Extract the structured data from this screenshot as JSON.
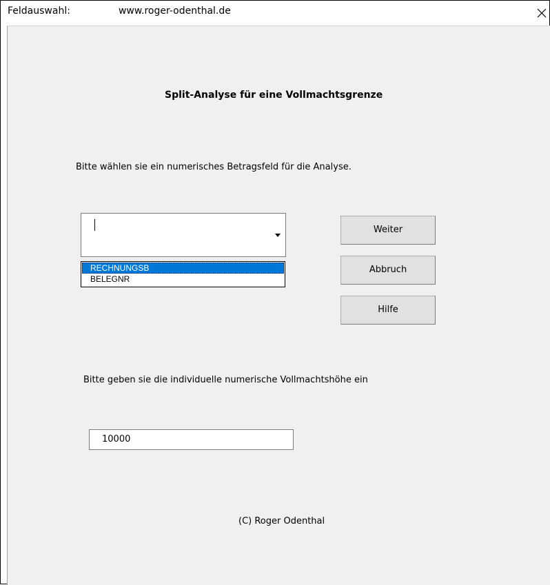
{
  "window": {
    "title": "Feldauswahl:",
    "url": "www.roger-odenthal.de"
  },
  "heading": "Split-Analyse für eine Vollmachtsgrenze",
  "field_prompt": "Bitte wählen sie ein numerisches Betragsfeld für die Analyse.",
  "field_combo": {
    "value": "",
    "options": [
      "RECHNUNGSB",
      "BELEGNR"
    ],
    "selected": "RECHNUNGSB"
  },
  "buttons": {
    "next": "Weiter",
    "cancel": "Abbruch",
    "help": "Hilfe"
  },
  "amount_prompt": "Bitte geben sie die individuelle numerische Vollmachtshöhe ein",
  "amount_value": "10000",
  "copyright": "(C) Roger Odenthal",
  "colors": {
    "selection": "#0078d7",
    "dialog_background": "#f0f0f0"
  }
}
